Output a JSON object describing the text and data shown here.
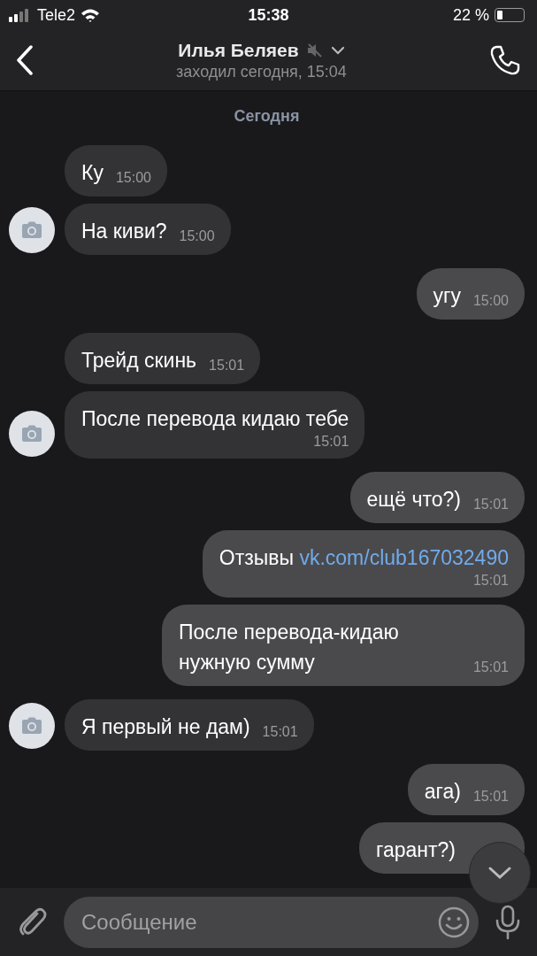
{
  "status_bar": {
    "carrier": "Tele2",
    "time": "15:38",
    "battery_text": "22 %"
  },
  "header": {
    "name": "Илья Беляев",
    "muted": true,
    "subtitle": "заходил сегодня, 15:04"
  },
  "date_separator": "Сегодня",
  "messages": [
    {
      "out": false,
      "avatar": false,
      "text": "Ку",
      "time": "15:00",
      "time_below": false
    },
    {
      "out": false,
      "avatar": true,
      "text": "На киви?",
      "time": "15:00",
      "time_below": false
    },
    {
      "out": true,
      "text": "угу",
      "time": "15:00",
      "time_below": false
    },
    {
      "out": false,
      "avatar": false,
      "text": "Трейд скинь",
      "time": "15:01",
      "time_below": false
    },
    {
      "out": false,
      "avatar": true,
      "text": "После перевода кидаю тебе",
      "time": "15:01",
      "time_below": true
    },
    {
      "out": true,
      "text": "ещё что?)",
      "time": "15:01",
      "time_below": false
    },
    {
      "out": true,
      "text": "Отзывы",
      "link": "vk.com/club167032490",
      "time": "15:01",
      "time_below": true
    },
    {
      "out": true,
      "text": "После перевода-кидаю нужную сумму",
      "time": "15:01",
      "time_below": false
    },
    {
      "out": false,
      "avatar": true,
      "text": "Я первый не дам)",
      "time": "15:01",
      "time_below": false
    },
    {
      "out": true,
      "text": "ага)",
      "time": "15:01",
      "time_below": false
    },
    {
      "out": true,
      "text": "гарант?)",
      "time_below": false
    }
  ],
  "composer": {
    "placeholder": "Сообщение"
  }
}
